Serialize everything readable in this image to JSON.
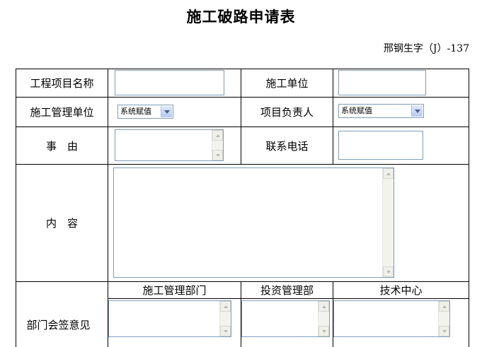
{
  "form": {
    "title": "施工破路申请表",
    "doc_number": "邢钢生字（J）-137"
  },
  "fields": {
    "project_name_label": "工程项目名称",
    "construction_unit_label": "施工单位",
    "construction_mgmt_unit_label": "施工管理单位",
    "construction_mgmt_unit_value": "系统赋值",
    "project_leader_label": "项目负责人",
    "project_leader_value": "系统赋值",
    "reason_label": "事　由",
    "contact_phone_label": "联系电话",
    "content_label": "内　容"
  },
  "countersign": {
    "label": "部门会签意见",
    "columns": [
      "施工管理部门",
      "投资管理部",
      "技术中心"
    ]
  },
  "colors": {
    "input_border": "#7f9db9",
    "scrollbar_bg": "#f3f3ee",
    "select_arrow_bg": "#b5c9f0"
  }
}
